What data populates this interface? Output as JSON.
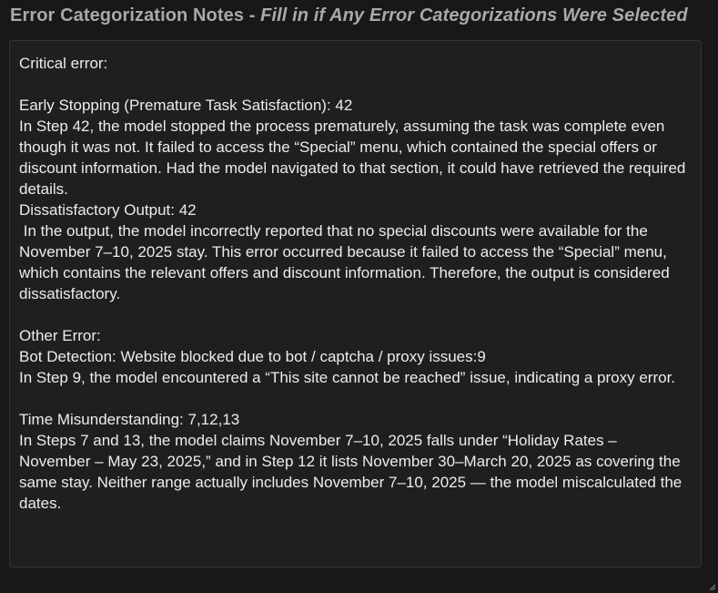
{
  "heading": {
    "title": "Error Categorization Notes",
    "separator": " - ",
    "subtitle": "Fill in if Any Error Categorizations Were Selected"
  },
  "notes": {
    "value": "Critical error:\n\nEarly Stopping (Premature Task Satisfaction): 42\nIn Step 42, the model stopped the process prematurely, assuming the task was complete even though it was not. It failed to access the “Special” menu, which contained the special offers or discount information. Had the model navigated to that section, it could have retrieved the required details.\nDissatisfactory Output: 42\n In the output, the model incorrectly reported that no special discounts were available for the November 7–10, 2025 stay. This error occurred because it failed to access the “Special” menu, which contains the relevant offers and discount information. Therefore, the output is considered dissatisfactory.\n\nOther Error:\nBot Detection: Website blocked due to bot / captcha / proxy issues:9\nIn Step 9, the model encountered a “This site cannot be reached” issue, indicating a proxy error.\n\nTime Misunderstanding: 7,12,13\nIn Steps 7 and 13, the model claims November 7–10, 2025 falls under “Holiday Rates – November – May 23, 2025,” and in Step 12 it lists November 30–March 20, 2025 as covering the same stay. Neither range actually includes November 7–10, 2025 — the model miscalculated the dates."
  },
  "icons": {
    "resize": "resize-grip-icon"
  }
}
